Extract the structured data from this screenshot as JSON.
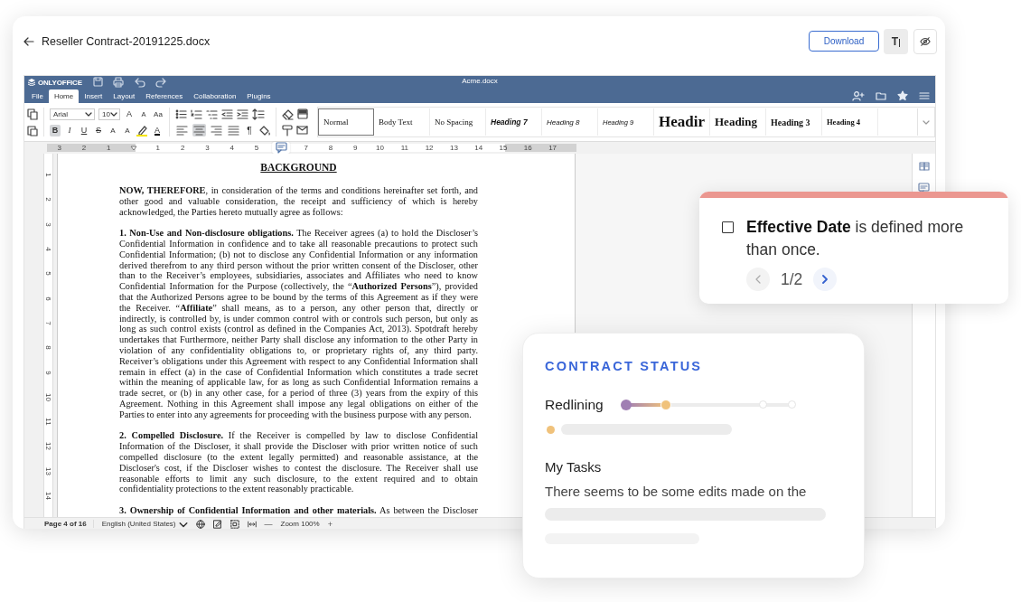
{
  "app_header": {
    "title": "Reseller Contract-20191225.docx",
    "download_label": "Download",
    "text_size_label": "T"
  },
  "editor": {
    "brand": "ONLYOFFICE",
    "file_name": "Acme.docx",
    "menu_tabs": [
      {
        "label": "File",
        "selected": false
      },
      {
        "label": "Home",
        "selected": true
      },
      {
        "label": "Insert",
        "selected": false
      },
      {
        "label": "Layout",
        "selected": false
      },
      {
        "label": "References",
        "selected": false
      },
      {
        "label": "Collaboration",
        "selected": false
      },
      {
        "label": "Plugins",
        "selected": false
      }
    ],
    "font_name": "Arial",
    "font_size": "10",
    "size_buttons": [
      {
        "label": "A",
        "kind": "grow"
      },
      {
        "label": "A",
        "kind": "shrink"
      },
      {
        "label": "Aa",
        "kind": "case"
      }
    ],
    "format_buttons": [
      {
        "label": "B",
        "kind": "bold",
        "selected": true
      },
      {
        "label": "I",
        "kind": "italic",
        "selected": false
      },
      {
        "label": "U",
        "kind": "underline",
        "selected": false
      },
      {
        "label": "S",
        "kind": "strike",
        "selected": false
      },
      {
        "label": "A",
        "kind": "superscript",
        "selected": false
      },
      {
        "label": "A",
        "kind": "subscript",
        "selected": false
      }
    ],
    "font_color_label": "A",
    "pilcrow_label": "¶",
    "alignments": [
      {
        "kind": "left",
        "selected": false
      },
      {
        "kind": "center",
        "selected": true
      },
      {
        "kind": "right",
        "selected": false
      },
      {
        "kind": "justify",
        "selected": false
      }
    ],
    "styles": [
      {
        "label": "Normal",
        "kind": "normal",
        "selected": true
      },
      {
        "label": "Body Text",
        "kind": "normal",
        "selected": false
      },
      {
        "label": "No Spacing",
        "kind": "normal",
        "selected": false
      },
      {
        "label": "Heading 7",
        "kind": "h7",
        "selected": false
      },
      {
        "label": "Heading 8",
        "kind": "h8",
        "selected": false
      },
      {
        "label": "Heading 9",
        "kind": "h9",
        "selected": false
      },
      {
        "label": "Headir",
        "kind": "h1",
        "selected": false
      },
      {
        "label": "Heading",
        "kind": "h2",
        "selected": false
      },
      {
        "label": "Heading 3",
        "kind": "h3",
        "selected": false
      },
      {
        "label": "Heading 4",
        "kind": "h4",
        "selected": false
      }
    ],
    "ruler": [
      {
        "kind": "tick",
        "label": "3"
      },
      {
        "kind": "tick",
        "label": "2"
      },
      {
        "kind": "tick",
        "label": "1"
      },
      {
        "kind": "indent"
      },
      {
        "kind": "tick",
        "label": "1"
      },
      {
        "kind": "tick",
        "label": "2"
      },
      {
        "kind": "tick",
        "label": "3"
      },
      {
        "kind": "tick",
        "label": "4"
      },
      {
        "kind": "tick",
        "label": "5"
      },
      {
        "kind": "comment"
      },
      {
        "kind": "tick",
        "label": "7"
      },
      {
        "kind": "tick",
        "label": "8"
      },
      {
        "kind": "tick",
        "label": "9"
      },
      {
        "kind": "tick",
        "label": "10"
      },
      {
        "kind": "tick",
        "label": "11"
      },
      {
        "kind": "tick",
        "label": "12"
      },
      {
        "kind": "tick",
        "label": "13"
      },
      {
        "kind": "tick",
        "label": "14"
      },
      {
        "kind": "tick",
        "label": "15"
      },
      {
        "kind": "tick",
        "label": "16"
      },
      {
        "kind": "tick",
        "label": "17"
      }
    ],
    "vertical_ruler": [
      "1",
      "2",
      "3",
      "4",
      "5",
      "6",
      "7",
      "8",
      "9",
      "10",
      "11",
      "12",
      "13",
      "14"
    ],
    "document": {
      "heading": "BACKGROUND",
      "paragraphs": [
        "**NOW, THEREFORE**, in consideration of the terms and conditions hereinafter set forth, and other good and valuable consideration, the receipt and sufficiency of which is hereby acknowledged, the Parties hereto mutually agree as follows:",
        "**1.   Non-Use and Non-disclosure obligations.** The Receiver agrees (a) to hold the Discloser’s Confidential Information in confidence and to take all reasonable precautions to protect such Confidential Information;  (b) not to disclose any Confidential Information or any information derived therefrom to any third person without the prior written consent of the Discloser, other than to the Receiver’s employees, subsidiaries, associates and Affiliates who need to know Confidential Information for the Purpose (collectively, the “**Authorized Persons**”), provided that the Authorized Persons agree to be bound by the terms of this Agreement as if they were the Receiver. “**Affiliate**” shall means, as to a person, any other person that, directly or indirectly, is controlled by, is under common control with or controls such person, but only as long as such control exists (control as defined in the Companies Act, 2013). Spotdraft hereby undertakes that Furthermore, neither Party shall disclose any information to the other Party in violation of any confidentiality obligations to, or proprietary rights of, any third party. Receiver’s obligations under this Agreement with respect to any Confidential Information shall remain in effect (a) in the case of Confidential Information which constitutes a trade secret within the meaning of applicable law, for as long as such Confidential Information remains a trade secret, or (b) in any other case, for a period of three (3) years from the expiry of this Agreement. Nothing in this Agreement shall impose any legal obligations on either of the Parties to enter into any agreements for proceeding with the business purpose with any person.",
        "**2.   Compelled Disclosure.**  If the Receiver is compelled by law to disclose Confidential Information of the Discloser, it shall provide the Discloser with prior written notice of such compelled disclosure (to the extent legally permitted) and reasonable assistance, at the Discloser's cost, if the Discloser wishes to contest the disclosure. The Receiver shall use reasonable efforts to limit any such disclosure, to the extent required and to obtain confidentiality protections to the extent reasonably practicable.",
        "**3.   Ownership of Confidential Information and other materials.**  As between the Discloser"
      ]
    },
    "status_bar": {
      "page": "Page 4 of 16",
      "language": "English (United States)",
      "zoom_out": "—",
      "zoom": "Zoom 100%",
      "zoom_in": "+"
    }
  },
  "issue_card": {
    "checked": false,
    "message": "**Effective Date** is defined more than once.",
    "pager": "1/2"
  },
  "status_card": {
    "title": "CONTRACT STATUS",
    "stage": "Redlining",
    "level": 0.24,
    "tasks_title": "My Tasks",
    "task_text": "There seems to be some edits made on the"
  }
}
